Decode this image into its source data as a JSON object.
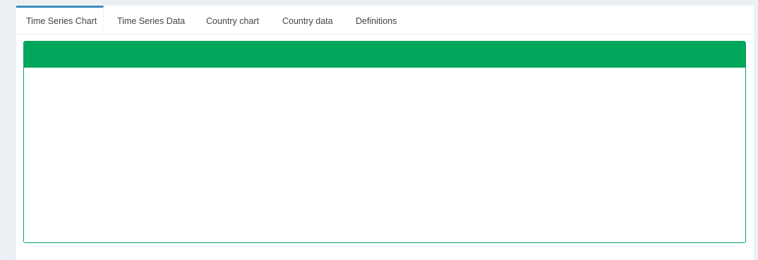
{
  "tabs": [
    {
      "label": "Time Series Chart",
      "active": true
    },
    {
      "label": "Time Series Data",
      "active": false
    },
    {
      "label": "Country chart",
      "active": false
    },
    {
      "label": "Country data",
      "active": false
    },
    {
      "label": "Definitions",
      "active": false
    }
  ],
  "colors": {
    "page_background": "#ecf0f5",
    "active_tab_accent": "#3c8dbc",
    "box_header": "#00a65a",
    "box_border": "#00a65a"
  },
  "box": {
    "title": ""
  }
}
